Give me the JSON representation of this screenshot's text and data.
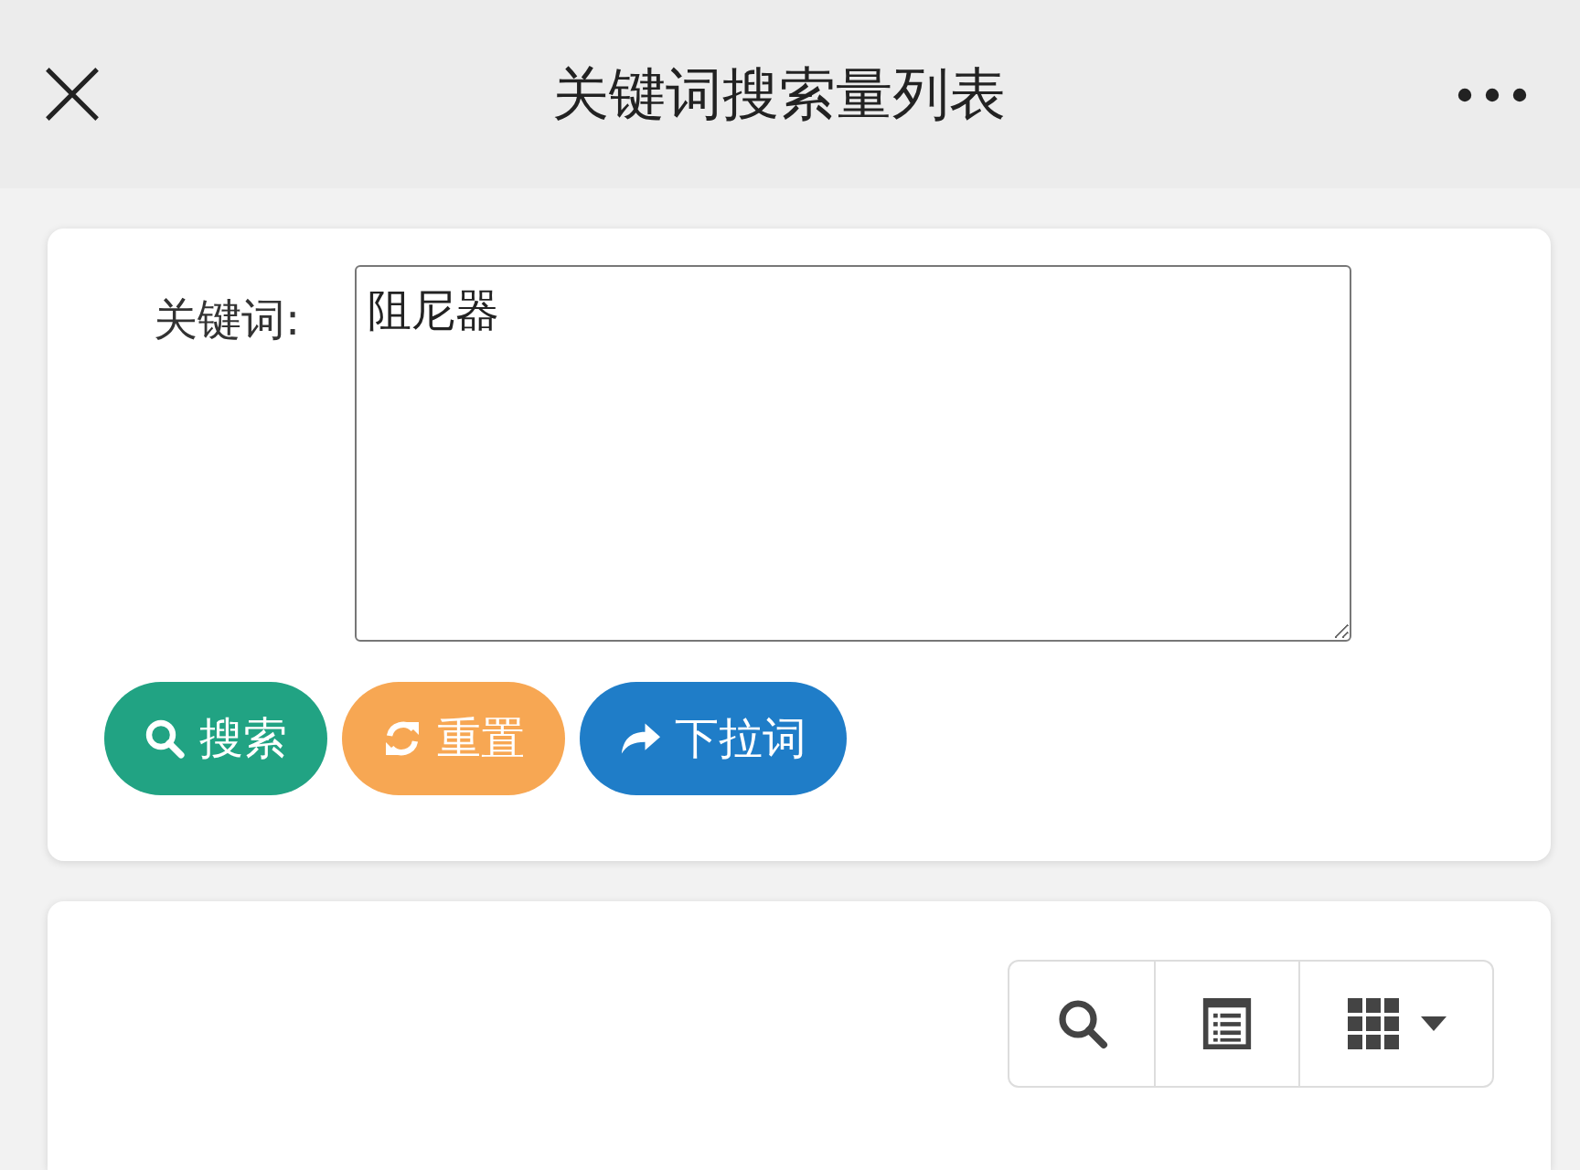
{
  "header": {
    "title": "关键词搜索量列表"
  },
  "form": {
    "label": "关键词:",
    "keyword": {
      "value": "阻尼器"
    },
    "buttons": [
      {
        "kind": "search",
        "label": "搜索",
        "color": "#21a383"
      },
      {
        "kind": "reset",
        "label": "重置",
        "color": "#f7a753"
      },
      {
        "kind": "share",
        "label": "下拉词",
        "color": "#1f7dc8"
      }
    ]
  },
  "toolbar": {
    "buttons": [
      {
        "kind": "search"
      },
      {
        "kind": "list"
      },
      {
        "kind": "columns"
      }
    ]
  }
}
